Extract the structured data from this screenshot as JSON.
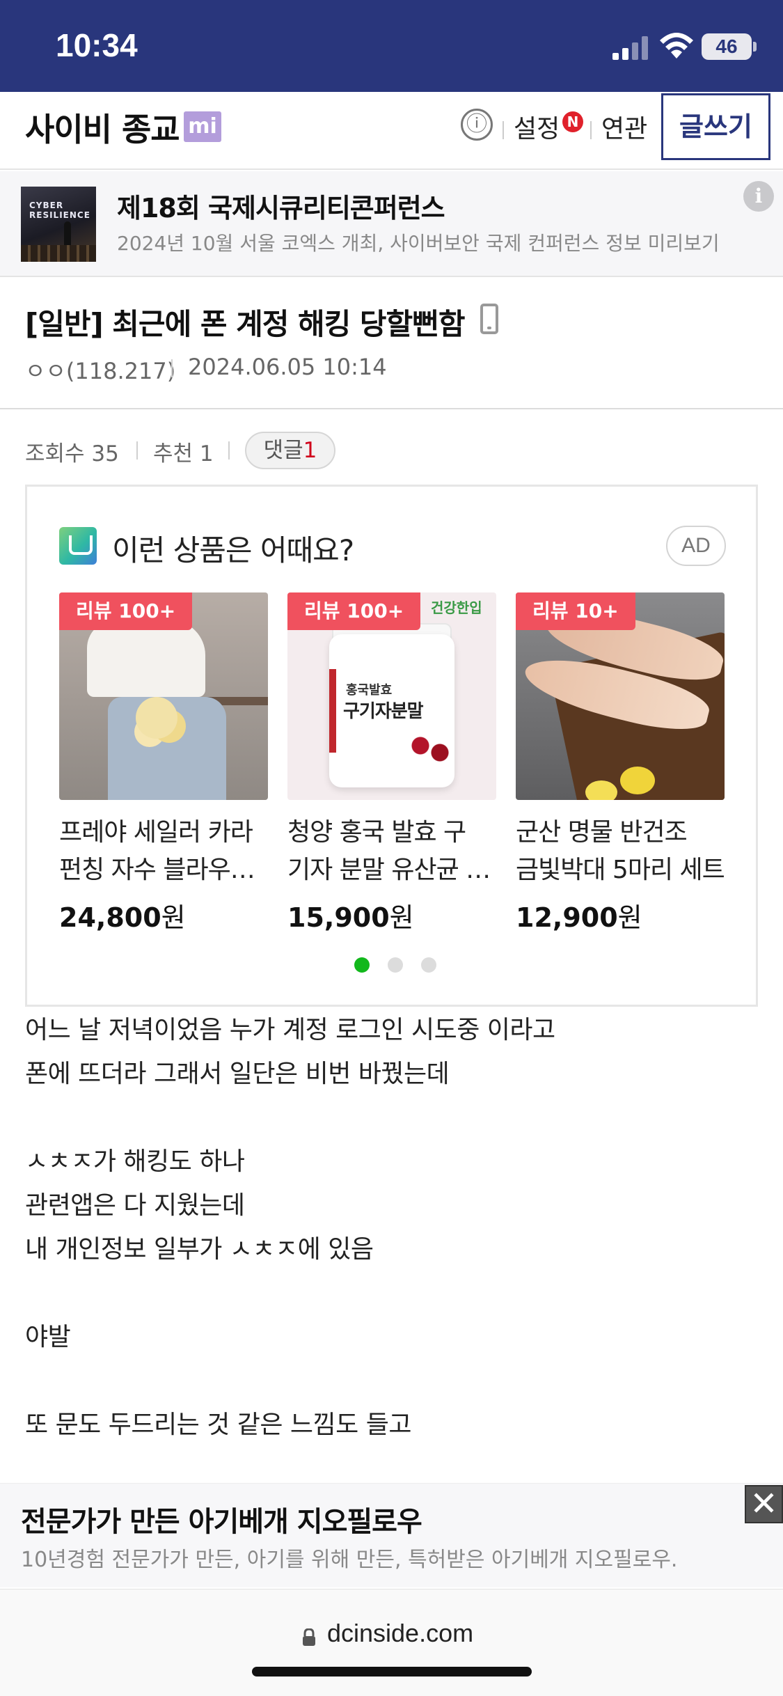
{
  "status_bar": {
    "time": "10:34",
    "battery": "46",
    "background": "#29367c"
  },
  "header": {
    "gallery_title": "사이비 종교",
    "badge": "mi",
    "info_icon": "ⓘ",
    "settings_label": "설정",
    "new_badge": "N",
    "related_label": "연관",
    "write_button": "글쓰기",
    "accent_color": "#29367c"
  },
  "promo": {
    "thumb_text": "CYBER RESILIENCE",
    "title": "제18회 국제시큐리티콘퍼런스",
    "description": "2024년 10월 서울 코엑스 개최, 사이버보안 국제 컨퍼런스 정보 미리보기",
    "info_icon": "i"
  },
  "post": {
    "title": "[일반] 최근에 폰 계정 해킹 당할뻔함",
    "author": "ㅇㅇ(118.217)",
    "date": "2024.06.05 10:14",
    "views_label": "조회수 35",
    "recommend_label": "추천 1",
    "comment_label": "댓글",
    "comment_count": "1",
    "body_lines": [
      "어느 날 저녁이었음 누가 계정 로그인 시도중 이라고",
      "폰에 뜨더라 그래서 일단은 비번 바꿨는데",
      "",
      "ㅅㅊㅈ가 해킹도 하나",
      "관련앱은 다 지웠는데",
      "내 개인정보 일부가 ㅅㅊㅈ에 있음",
      "",
      "야발",
      "",
      "또 문도 두드리는 것 같은 느낌도 들고"
    ]
  },
  "ad_box": {
    "heading": "이런 상품은 어때요?",
    "ad_label": "AD",
    "products": [
      {
        "badge": "리뷰 100+",
        "name_line1": "프레야 세일러 카라",
        "name_line2": "펀칭 자수 블라우스 반팔",
        "price": "24,800",
        "unit": "원"
      },
      {
        "badge": "리뷰 100+",
        "name_line1": "청양 홍국 발효 구",
        "name_line2": "기자 분말 유산균 함유",
        "price": "15,900",
        "unit": "원",
        "img_brand": "건강한입",
        "img_label1": "홍국발효",
        "img_label2": "구기자분말"
      },
      {
        "badge": "리뷰 10+",
        "name_line1": "군산 명물 반건조",
        "name_line2": "금빛박대 5마리 세트",
        "price": "12,900",
        "unit": "원"
      }
    ],
    "carousel_active_index": 0,
    "carousel_count": 3
  },
  "bottom_ad": {
    "title": "전문가가 만든 아기베개 지오필로우",
    "description": "10년경험 전문가가 만든, 아기를 위해 만든, 특허받은 아기베개 지오필로우.",
    "close_icon": "✕"
  },
  "browser": {
    "url": "dcinside.com"
  }
}
